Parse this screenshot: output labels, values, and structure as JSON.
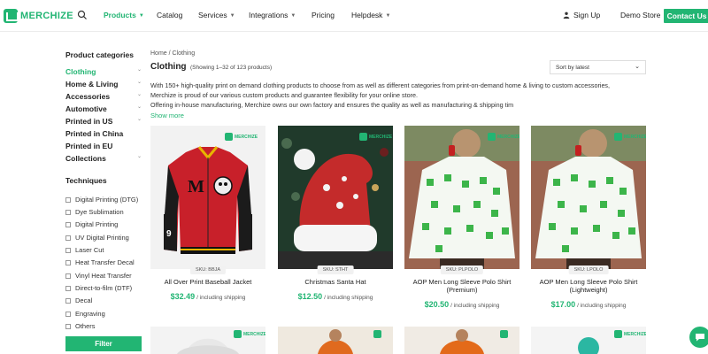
{
  "brand": "MERCHIZE",
  "colors": {
    "accent": "#22b573",
    "text": "#222222"
  },
  "header": {
    "nav": [
      {
        "label": "Products",
        "dropdown": true,
        "active": true
      },
      {
        "label": "Catalog",
        "dropdown": false
      },
      {
        "label": "Services",
        "dropdown": true
      },
      {
        "label": "Integrations",
        "dropdown": true
      },
      {
        "label": "Pricing",
        "dropdown": false
      },
      {
        "label": "Helpdesk",
        "dropdown": true
      }
    ],
    "signup": "Sign Up",
    "demo_store": "Demo Store",
    "contact": "Contact Us"
  },
  "sidebar": {
    "title": "Product categories",
    "categories": [
      {
        "label": "Clothing",
        "active": true,
        "expandable": true
      },
      {
        "label": "Home & Living",
        "expandable": true
      },
      {
        "label": "Accessories",
        "expandable": true
      },
      {
        "label": "Automotive",
        "expandable": true
      },
      {
        "label": "Printed in US",
        "expandable": true
      },
      {
        "label": "Printed in China",
        "expandable": false
      },
      {
        "label": "Printed in EU",
        "expandable": false
      },
      {
        "label": "Collections",
        "expandable": true
      }
    ],
    "techniques_title": "Techniques",
    "techniques": [
      "Digital Printing (DTG)",
      "Dye Sublimation",
      "Digital Printing",
      "UV Digital Printing",
      "Laser Cut",
      "Heat Transfer Decal",
      "Vinyl Heat Transfer",
      "Direct-to-film (DTF)",
      "Decal",
      "Engraving",
      "Others"
    ],
    "filter": "Filter"
  },
  "main": {
    "breadcrumb": "Home / Clothing",
    "title": "Clothing",
    "showing": "(Showing 1–32 of 123 products)",
    "sort": "Sort by latest",
    "description": [
      "With 150+ high-quality print on demand clothing products to choose from as well as different categories from print-on-demand home & living to custom accessories,",
      "Merchize is proud of our various custom products and guarantee flexibility for your online store.",
      "Offering in-house manufacturing, Merchize owns our own factory and ensures the quality as well as manufacturing & shipping tim"
    ],
    "show_more": "Show more",
    "products": [
      {
        "sku": "SKU: BBJA",
        "name": "All Over Print Baseball Jacket",
        "price": "$32.49",
        "shipping": "/ including shipping"
      },
      {
        "sku": "SKU: STHT",
        "name": "Christmas Santa Hat",
        "price": "$12.50",
        "shipping": "/ including shipping"
      },
      {
        "sku": "SKU: PLPOLO",
        "name": "AOP Men Long Sleeve Polo Shirt (Premium)",
        "price": "$20.50",
        "shipping": "/ including shipping"
      },
      {
        "sku": "SKU: LPOLO",
        "name": "AOP Men Long Sleeve Polo Shirt (Lightweight)",
        "price": "$17.00",
        "shipping": "/ including shipping"
      }
    ]
  }
}
